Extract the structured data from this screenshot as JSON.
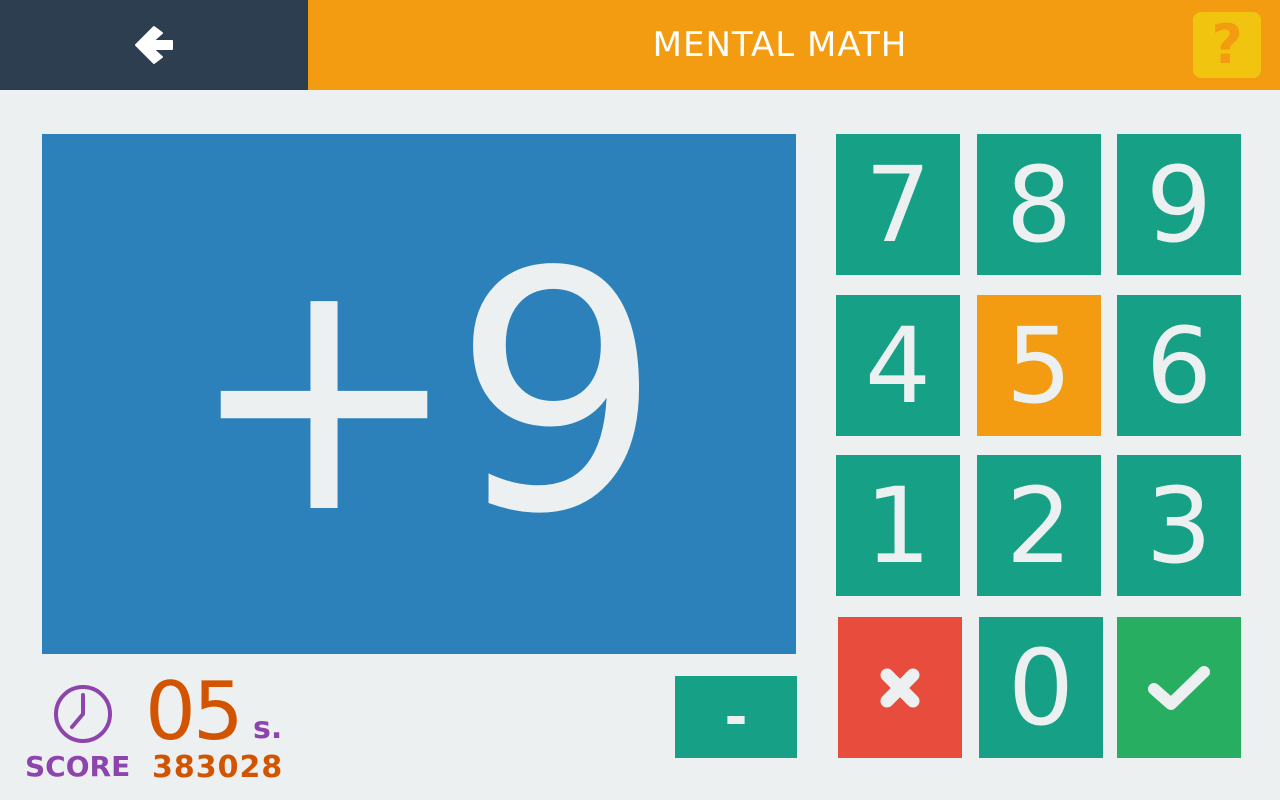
{
  "header": {
    "title": "MENTAL MATH",
    "back_icon": "arrow-left-icon",
    "help_label": "?"
  },
  "problem": {
    "text": "+9"
  },
  "keypad": {
    "keys": [
      "7",
      "8",
      "9",
      "4",
      "5",
      "6",
      "1",
      "2",
      "3",
      "0"
    ],
    "active_key": "5",
    "minus_label": "-",
    "cancel_icon": "close-icon",
    "confirm_icon": "checkmark-icon"
  },
  "status": {
    "timer_value": "05",
    "timer_unit": "s.",
    "score_label": "SCORE",
    "score_value": "383028"
  },
  "colors": {
    "header": "#f39c12",
    "back_panel": "#2c3e50",
    "problem_bg": "#2c81ba",
    "key": "#16a085",
    "key_active": "#f39c12",
    "cancel": "#e74c3c",
    "confirm": "#27ae60",
    "timer": "#d35400",
    "score_label": "#8e44ad"
  }
}
